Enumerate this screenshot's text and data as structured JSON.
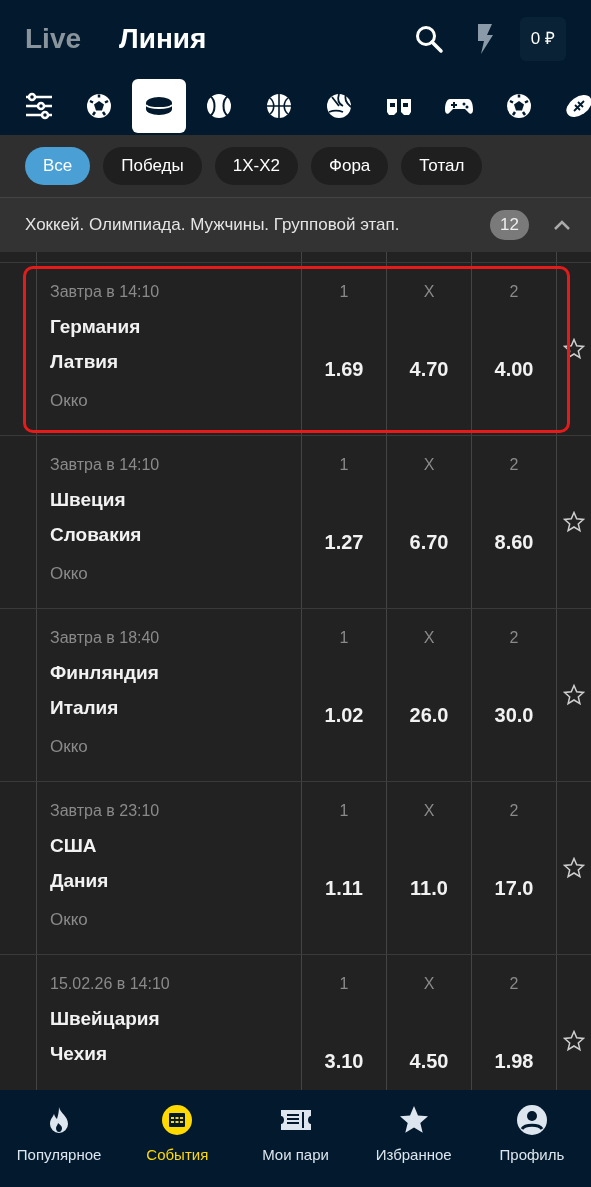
{
  "header": {
    "tabs": [
      {
        "label": "Live",
        "selected": false
      },
      {
        "label": "Линия",
        "selected": true
      }
    ],
    "balance": "0 ₽"
  },
  "sports": [
    {
      "kind": "filters",
      "selected": false
    },
    {
      "kind": "soccer",
      "selected": false
    },
    {
      "kind": "hockey",
      "selected": true
    },
    {
      "kind": "tennis",
      "selected": false
    },
    {
      "kind": "basketball",
      "selected": false
    },
    {
      "kind": "volleyball",
      "selected": false
    },
    {
      "kind": "gloves",
      "selected": false
    },
    {
      "kind": "gamepad",
      "selected": false
    },
    {
      "kind": "soccer",
      "selected": false
    },
    {
      "kind": "rugby",
      "selected": false
    }
  ],
  "filters": [
    {
      "label": "Все",
      "selected": true
    },
    {
      "label": "Победы",
      "selected": false
    },
    {
      "label": "1X-X2",
      "selected": false
    },
    {
      "label": "Фора",
      "selected": false
    },
    {
      "label": "Тотал",
      "selected": false
    }
  ],
  "section": {
    "title": "Хоккей. Олимпиада. Мужчины. Групповой этап.",
    "count": "12",
    "expanded": true
  },
  "matches": [
    {
      "time": "Завтра в 14:10",
      "team1": "Германия",
      "team2": "Латвия",
      "league": "Окко",
      "odds": [
        {
          "label": "1",
          "value": "1.69"
        },
        {
          "label": "X",
          "value": "4.70"
        },
        {
          "label": "2",
          "value": "4.00"
        }
      ],
      "highlighted": true
    },
    {
      "time": "Завтра в 14:10",
      "team1": "Швеция",
      "team2": "Словакия",
      "league": "Окко",
      "odds": [
        {
          "label": "1",
          "value": "1.27"
        },
        {
          "label": "X",
          "value": "6.70"
        },
        {
          "label": "2",
          "value": "8.60"
        }
      ],
      "highlighted": false
    },
    {
      "time": "Завтра в 18:40",
      "team1": "Финляндия",
      "team2": "Италия",
      "league": "Окко",
      "odds": [
        {
          "label": "1",
          "value": "1.02"
        },
        {
          "label": "X",
          "value": "26.0"
        },
        {
          "label": "2",
          "value": "30.0"
        }
      ],
      "highlighted": false
    },
    {
      "time": "Завтра в 23:10",
      "team1": "США",
      "team2": "Дания",
      "league": "Окко",
      "odds": [
        {
          "label": "1",
          "value": "1.11"
        },
        {
          "label": "X",
          "value": "11.0"
        },
        {
          "label": "2",
          "value": "17.0"
        }
      ],
      "highlighted": false
    },
    {
      "time": "15.02.26 в 14:10",
      "team1": "Швейцария",
      "team2": "Чехия",
      "odds": [
        {
          "label": "1",
          "value": "3.10"
        },
        {
          "label": "X",
          "value": "4.50"
        },
        {
          "label": "2",
          "value": "1.98"
        }
      ],
      "highlighted": false
    }
  ],
  "nav": [
    {
      "kind": "flame",
      "label": "Популярное",
      "selected": false
    },
    {
      "kind": "calendar",
      "label": "События",
      "selected": true
    },
    {
      "kind": "ticket",
      "label": "Мои пари",
      "selected": false
    },
    {
      "kind": "star",
      "label": "Избранное",
      "selected": false
    },
    {
      "kind": "profile",
      "label": "Профиль",
      "selected": false
    }
  ]
}
